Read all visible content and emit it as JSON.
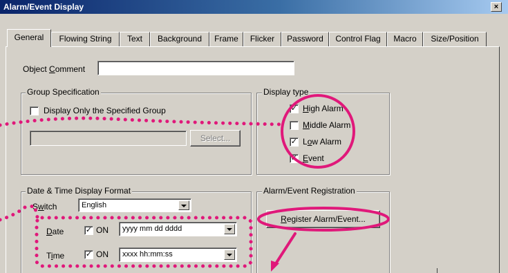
{
  "window": {
    "title": "Alarm/Event Display",
    "close_glyph": "×"
  },
  "tabs": [
    {
      "label": "General",
      "active": true
    },
    {
      "label": "Flowing String",
      "active": false
    },
    {
      "label": "Text",
      "active": false
    },
    {
      "label": "Background",
      "active": false
    },
    {
      "label": "Frame",
      "active": false
    },
    {
      "label": "Flicker",
      "active": false
    },
    {
      "label": "Password",
      "active": false
    },
    {
      "label": "Control Flag",
      "active": false
    },
    {
      "label": "Macro",
      "active": false
    },
    {
      "label": "Size/Position",
      "active": false
    }
  ],
  "object_comment": {
    "label_pre": "Object ",
    "label_key": "C",
    "label_post": "omment",
    "value": ""
  },
  "group_spec": {
    "legend": "Group Specification",
    "checkbox_label": "Display Only the Specified Group",
    "checked": false,
    "group_value": "",
    "select_label": "Select..."
  },
  "display_type": {
    "legend": "Display type",
    "items": [
      {
        "pre": "",
        "key": "H",
        "post": "igh Alarm",
        "checked": true
      },
      {
        "pre": "",
        "key": "M",
        "post": "iddle Alarm",
        "checked": false
      },
      {
        "pre": "L",
        "key": "o",
        "post": "w Alarm",
        "checked": true
      },
      {
        "pre": "",
        "key": "E",
        "post": "vent",
        "checked": true
      }
    ]
  },
  "date_time": {
    "legend": "Date & Time Display Format",
    "switch_label_pre": "S",
    "switch_label_key": "w",
    "switch_label_post": "itch",
    "switch_value": "English",
    "date_label_key": "D",
    "date_label_post": "ate",
    "date_on_label": "ON",
    "date_on": true,
    "date_format": "yyyy mm dd  dddd",
    "time_label_pre": "T",
    "time_label_key": "i",
    "time_label_post": "me",
    "time_on_label": "ON",
    "time_on": true,
    "time_format": "xxxx hh:mm:ss"
  },
  "registration": {
    "legend": "Alarm/Event Registration",
    "button_key": "R",
    "button_post": "egister Alarm/Event..."
  },
  "annotation_colors": {
    "highlight": "#e0187a"
  }
}
